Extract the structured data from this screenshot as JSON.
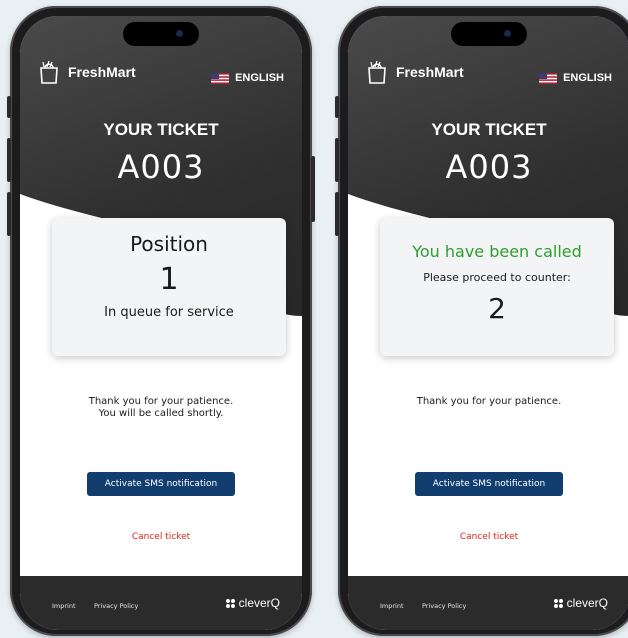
{
  "phones": [
    {
      "brand": "FreshMart",
      "language": "ENGLISH",
      "ticket_title": "YOUR TICKET",
      "ticket_number": "A003",
      "card": {
        "heading": "Position",
        "value": "1",
        "subtitle": "In queue for service"
      },
      "message_line1": "Thank you for your patience.",
      "message_line2": "You will be called shortly.",
      "sms_button": "Activate SMS notification",
      "cancel_link": "Cancel ticket",
      "footer": {
        "imprint": "Imprint",
        "privacy": "Privacy Policy",
        "logo_text": "cleverQ"
      }
    },
    {
      "brand": "FreshMart",
      "language": "ENGLISH",
      "ticket_title": "YOUR TICKET",
      "ticket_number": "A003",
      "card": {
        "heading": "You have been called",
        "prompt": "Please proceed to counter:",
        "value": "2"
      },
      "message_line1": "Thank you for your patience.",
      "sms_button": "Activate SMS notification",
      "cancel_link": "Cancel ticket",
      "footer": {
        "imprint": "Imprint",
        "privacy": "Privacy Policy",
        "logo_text": "cleverQ"
      }
    }
  ],
  "colors": {
    "called_green": "#2e9d2f",
    "sms_blue": "#123e6f",
    "cancel_red": "#e2231a",
    "footer_dark": "#2b2b2b"
  },
  "icons": [
    "shopping-bag-icon",
    "us-flag-icon",
    "cleverq-logo-icon"
  ]
}
